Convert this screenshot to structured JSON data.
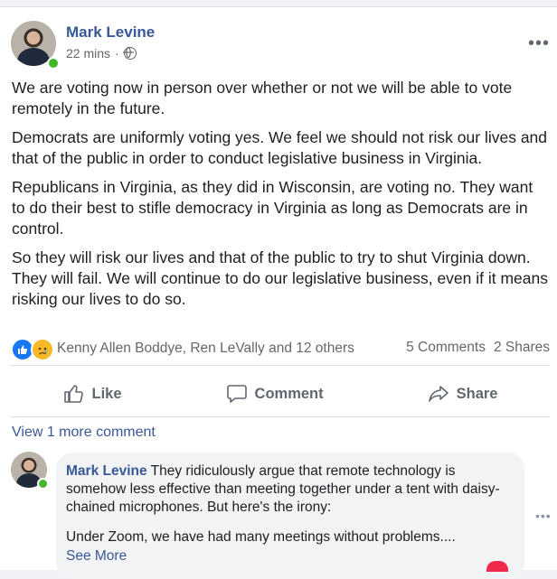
{
  "post": {
    "author": "Mark Levine",
    "timestamp": "22 mins",
    "separator": "·",
    "privacy_icon": "globe-icon",
    "more_icon": "more-options-icon",
    "paragraphs": [
      "We are voting now in person over whether or not we will be able to vote remotely in the future.",
      "Democrats are uniformly voting yes. We feel we should not risk our lives and that of the public in order to conduct legislative business in Virginia.",
      "Republicans in Virginia, as they did in Wisconsin, are voting no. They want to do their best to stifle democracy in Virginia as long as Democrats are in control.",
      "So they will risk our lives and that of the public to try to shut Virginia down. They will fail. We will continue to do our legislative business, even if it means risking our lives to do so."
    ]
  },
  "reactions": {
    "icons": [
      "like-reaction-icon",
      "sad-reaction-icon"
    ],
    "names": "Kenny Allen Boddye, Ren LeVally and 12 others",
    "comments": "5 Comments",
    "shares": "2 Shares"
  },
  "actions": {
    "like": "Like",
    "comment": "Comment",
    "share": "Share"
  },
  "comments": {
    "view_more": "View 1 more comment",
    "items": [
      {
        "author": "Mark Levine",
        "text": "They ridiculously argue that remote technology is somehow less effective than meeting together under a tent with daisy-chained microphones. But here's the irony:",
        "text2": "Under Zoom, we have had many meetings without problems....",
        "see_more": "See More"
      }
    ]
  },
  "colors": {
    "link": "#385898",
    "like_blue": "#1877f2",
    "online_green": "#42b72a",
    "text": "#1c1e21",
    "muted": "#65676b"
  }
}
